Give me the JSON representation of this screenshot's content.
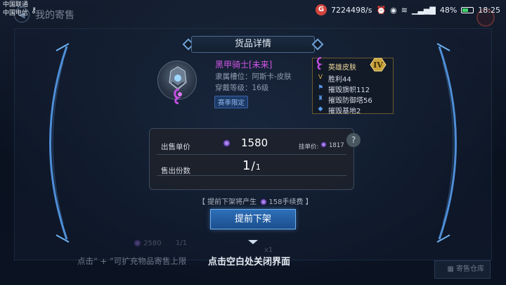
{
  "status_bar": {
    "carrier_1": "中国联通",
    "carrier_2": "中国电信",
    "network_speed": "7224498/s",
    "battery_percent": "48%",
    "time": "18:25"
  },
  "background": {
    "page_title": "我的寄售",
    "list_price": "2580",
    "list_quantity": "1/1",
    "list_count": "x1",
    "hint_text": "点击“ + ”可扩充物品寄售上限",
    "warehouse_label": "寄售仓库"
  },
  "modal": {
    "title": "货品详情",
    "item_name": "黑甲骑士[未来]",
    "slot_label": "隶属槽位：阿斯卡-皮肤",
    "level_label": "穿戴等级：16级",
    "season_tag": "赛季限定",
    "attributes": {
      "header": "英雄皮肤",
      "rank": "IV",
      "rows": [
        "胜利44",
        "摧毁旗帜112",
        "摧毁防御塔56",
        "摧毁基地2"
      ]
    },
    "price": {
      "label": "出售单价",
      "value": "1580",
      "unit_label": "挂单价:",
      "unit_value": "1817"
    },
    "quantity": {
      "label": "售出份数",
      "current": "1",
      "total": "1"
    },
    "help_symbol": "?",
    "fee": {
      "prefix": "【 提前下架将产生",
      "amount": "158手续费",
      "suffix": "】"
    },
    "action_button": "提前下架",
    "close_hint": "点击空白处关闭界面"
  },
  "colors": {
    "item_name": "#d256e8",
    "action_button": "#2d6fb8",
    "rank_badge": "#c8a23c"
  }
}
